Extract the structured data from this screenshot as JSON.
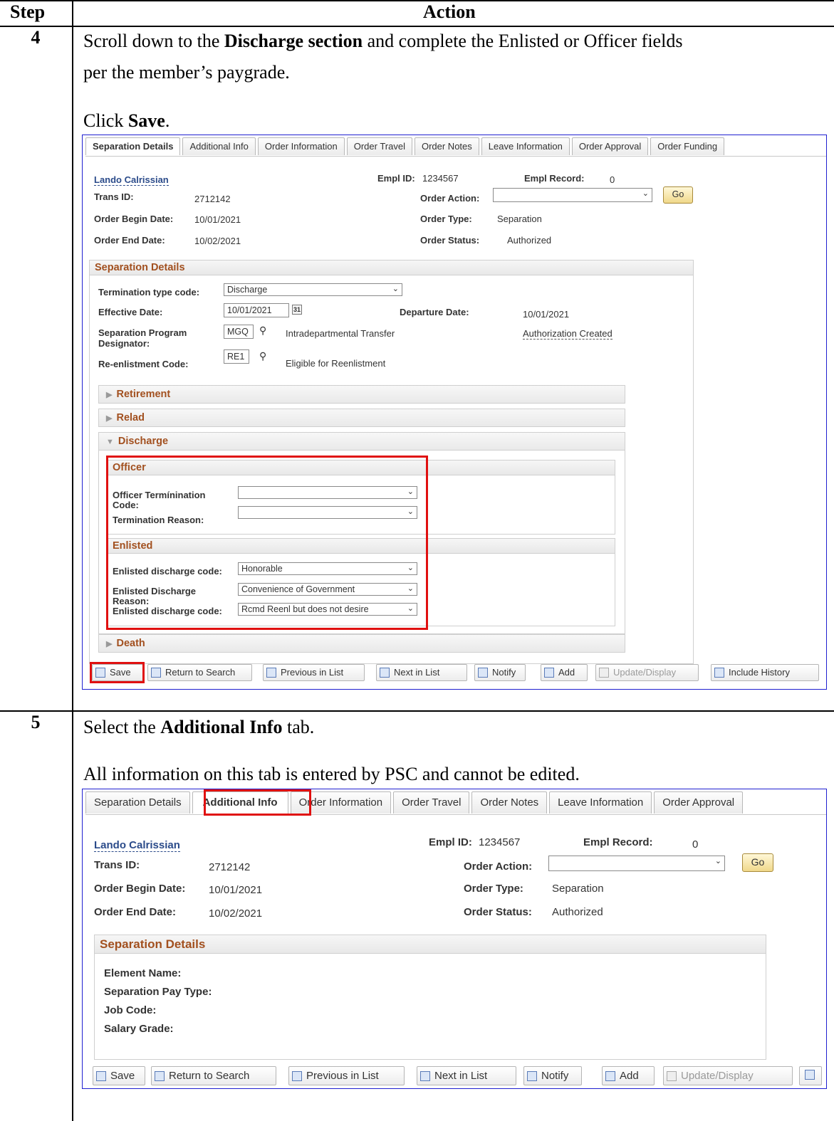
{
  "table": {
    "header_step": "Step",
    "header_action": "Action"
  },
  "step4": {
    "number": "4",
    "line1_pre": "Scroll down to the ",
    "line1_bold": "Discharge section",
    "line1_post": " and complete the Enlisted or Officer fields",
    "line2": "per the member’s paygrade.",
    "click_pre": "Click ",
    "click_bold": "Save",
    "click_post": "."
  },
  "step5": {
    "number": "5",
    "line1_pre": "Select the ",
    "line1_bold": "Additional Info",
    "line1_post": " tab.",
    "line2": "All information on this tab is entered by PSC and cannot be edited."
  },
  "shot1": {
    "tabs": [
      "Separation Details",
      "Additional Info",
      "Order Information",
      "Order Travel",
      "Order Notes",
      "Leave Information",
      "Order Approval",
      "Order Funding"
    ],
    "name_link": "Lando Calrissian",
    "empl_id_label": "Empl ID:",
    "empl_id": "1234567",
    "empl_record_label": "Empl Record:",
    "empl_record": "0",
    "trans_id_label": "Trans ID:",
    "trans_id": "2712142",
    "order_action_label": "Order Action:",
    "order_action": "",
    "go": "Go",
    "order_begin_label": "Order Begin Date:",
    "order_begin": "10/01/2021",
    "order_type_label": "Order Type:",
    "order_type": "Separation",
    "order_end_label": "Order End Date:",
    "order_end": "10/02/2021",
    "order_status_label": "Order Status:",
    "order_status": "Authorized",
    "sep_details_header": "Separation Details",
    "term_type_label": "Termination type code:",
    "term_type": "Discharge",
    "effective_date_label": "Effective Date:",
    "effective_date": "10/01/2021",
    "departure_date_label": "Departure Date:",
    "departure_date": "10/01/2021",
    "sep_program_label_1": "Separation Program",
    "sep_program_label_2": "Designator:",
    "sep_program": "MGQ",
    "sep_program_desc": "Intradepartmental Transfer",
    "authorization_link": "Authorization Created",
    "reenlist_label": "Re-enlistment Code:",
    "reenlist": "RE1",
    "reenlist_desc": "Eligible for Reenlistment",
    "retirement": "Retirement",
    "relad": "Relad",
    "discharge": "Discharge",
    "officer_header": "Officer",
    "officer_term_label_1": "Officer Termínination",
    "officer_term_label_2": "Code:",
    "officer_term": "",
    "term_reason_label": "Termination Reason:",
    "term_reason": "",
    "enlisted_header": "Enlisted",
    "enl_code_label": "Enlisted discharge code:",
    "enl_code": "Honorable",
    "enl_reason_label_1": "Enlisted Discharge",
    "enl_reason_label_2": "Reason:",
    "enl_reason": "Convenience of Government",
    "enl_code2_label": "Enlisted discharge code:",
    "enl_code2": "Rcmd Reenl but does not desire",
    "death": "Death",
    "toolbar": [
      "Save",
      "Return to Search",
      "Previous in List",
      "Next in List",
      "Notify",
      "Add",
      "Update/Display",
      "Include History"
    ]
  },
  "shot2": {
    "tabs": [
      "Separation Details",
      "Additional Info",
      "Order Information",
      "Order Travel",
      "Order Notes",
      "Leave Information",
      "Order Approval"
    ],
    "name_link": "Lando Calrissian",
    "empl_id_label": "Empl ID:",
    "empl_id": "1234567",
    "empl_record_label": "Empl Record:",
    "empl_record": "0",
    "trans_id_label": "Trans ID:",
    "trans_id": "2712142",
    "order_action_label": "Order Action:",
    "order_action": "",
    "go": "Go",
    "order_begin_label": "Order Begin Date:",
    "order_begin": "10/01/2021",
    "order_type_label": "Order Type:",
    "order_type": "Separation",
    "order_end_label": "Order End Date:",
    "order_end": "10/02/2021",
    "order_status_label": "Order Status:",
    "order_status": "Authorized",
    "sep_details_header": "Separation Details",
    "element_name_label": "Element Name:",
    "sep_pay_type_label": "Separation Pay Type:",
    "job_code_label": "Job Code:",
    "salary_grade_label": "Salary Grade:",
    "toolbar": [
      "Save",
      "Return to Search",
      "Previous in List",
      "Next in List",
      "Notify",
      "Add",
      "Update/Display"
    ]
  },
  "colors": {
    "highlight": "#e01010",
    "section_title": "#a2501f",
    "link": "#2b4b8a",
    "screenshot_border": "#1f1fd0"
  }
}
